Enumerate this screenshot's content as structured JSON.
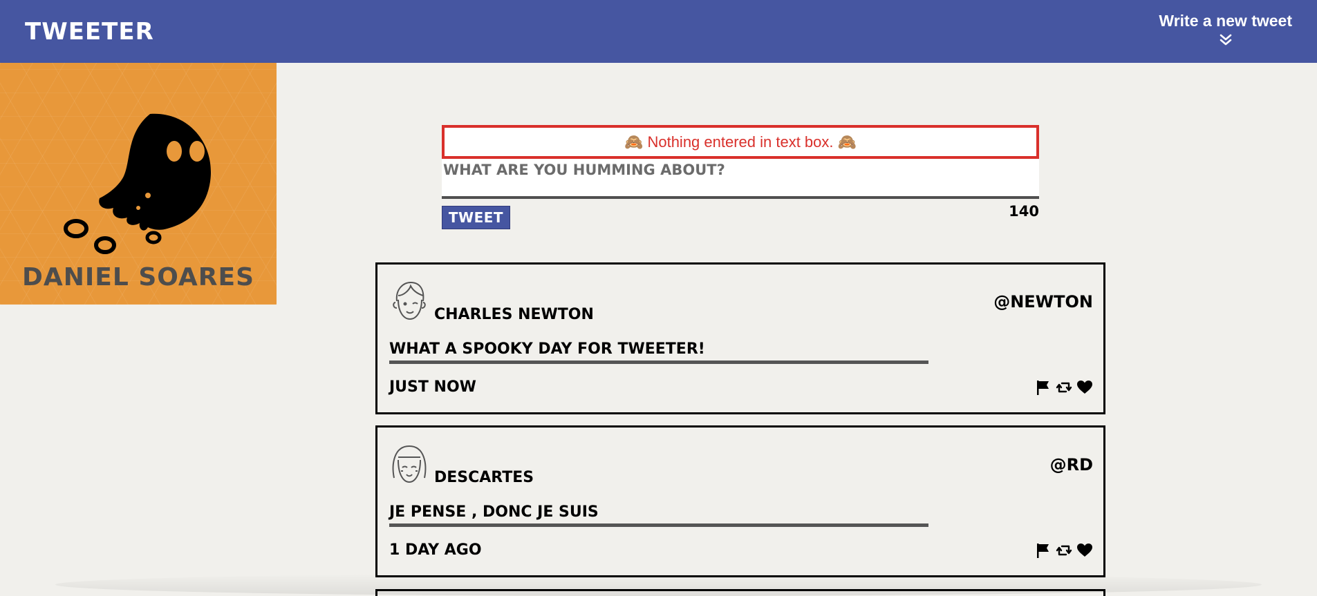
{
  "nav": {
    "brand": "TWEETER",
    "compose_label": "Write a new tweet",
    "compose_icon": "double-chevron-down-icon",
    "background": "#4656a1"
  },
  "profile": {
    "name": "DANIEL SOARES",
    "avatar_icon": "ghost-icon",
    "background": "#e8983a"
  },
  "compose": {
    "error": "🙈 Nothing entered in text box. 🙈",
    "placeholder": "What are you humming about?",
    "button": "TWEET",
    "counter": "140",
    "error_color": "#d9302b"
  },
  "tweets": [
    {
      "name": "CHARLES NEWTON",
      "handle": "@NEWTON",
      "text": "WHAT A SPOOKY DAY FOR TWEETER!",
      "time": "JUST NOW",
      "avatar_icon": "boy-face-icon"
    },
    {
      "name": "DESCARTES",
      "handle": "@RD",
      "text": "JE PENSE , DONC JE SUIS",
      "time": "1 DAY AGO",
      "avatar_icon": "girl-face-icon"
    }
  ]
}
